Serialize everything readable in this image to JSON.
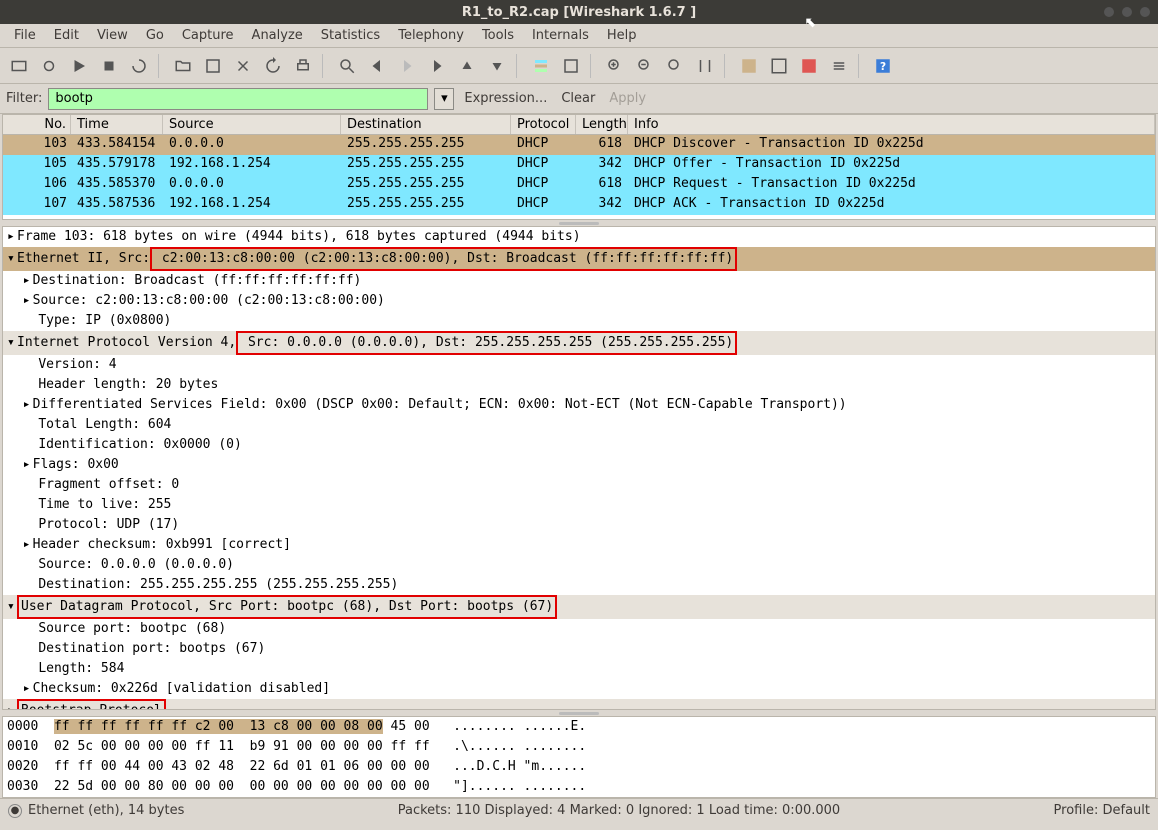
{
  "title": "R1_to_R2.cap   [Wireshark 1.6.7 ]",
  "menu": [
    "File",
    "Edit",
    "View",
    "Go",
    "Capture",
    "Analyze",
    "Statistics",
    "Telephony",
    "Tools",
    "Internals",
    "Help"
  ],
  "filter_label": "Filter:",
  "filter_value": "bootp",
  "filter_actions": {
    "expr": "Expression...",
    "clear": "Clear",
    "apply": "Apply"
  },
  "columns": [
    "No.",
    "Time",
    "Source",
    "Destination",
    "Protocol",
    "Length",
    "Info"
  ],
  "rows": [
    {
      "no": "103",
      "time": "433.584154",
      "src": "0.0.0.0",
      "dst": "255.255.255.255",
      "proto": "DHCP",
      "len": "618",
      "info": "DHCP Discover - Transaction ID 0x225d",
      "sel": true
    },
    {
      "no": "105",
      "time": "435.579178",
      "src": "192.168.1.254",
      "dst": "255.255.255.255",
      "proto": "DHCP",
      "len": "342",
      "info": "DHCP Offer    - Transaction ID 0x225d",
      "sel": false
    },
    {
      "no": "106",
      "time": "435.585370",
      "src": "0.0.0.0",
      "dst": "255.255.255.255",
      "proto": "DHCP",
      "len": "618",
      "info": "DHCP Request  - Transaction ID 0x225d",
      "sel": false
    },
    {
      "no": "107",
      "time": "435.587536",
      "src": "192.168.1.254",
      "dst": "255.255.255.255",
      "proto": "DHCP",
      "len": "342",
      "info": "DHCP ACK      - Transaction ID 0x225d",
      "sel": false
    }
  ],
  "detail": {
    "frame": "Frame 103: 618 bytes on wire (4944 bits), 618 bytes captured (4944 bits)",
    "eth_pre": "Ethernet II, Src:",
    "eth_hl": " c2:00:13:c8:00:00 (c2:00:13:c8:00:00), Dst: Broadcast (ff:ff:ff:ff:ff:ff)",
    "eth_dst": "Destination: Broadcast (ff:ff:ff:ff:ff:ff)",
    "eth_src": "Source: c2:00:13:c8:00:00 (c2:00:13:c8:00:00)",
    "eth_type": "Type: IP (0x0800)",
    "ip_pre": "Internet Protocol Version 4,",
    "ip_hl": " Src: 0.0.0.0 (0.0.0.0), Dst: 255.255.255.255 (255.255.255.255)",
    "ip_ver": "Version: 4",
    "ip_hlen": "Header length: 20 bytes",
    "ip_dsf": "Differentiated Services Field: 0x00 (DSCP 0x00: Default; ECN: 0x00: Not-ECT (Not ECN-Capable Transport))",
    "ip_tl": "Total Length: 604",
    "ip_id": "Identification: 0x0000 (0)",
    "ip_flags": "Flags: 0x00",
    "ip_frag": "Fragment offset: 0",
    "ip_ttl": "Time to live: 255",
    "ip_proto": "Protocol: UDP (17)",
    "ip_csum": "Header checksum: 0xb991 [correct]",
    "ip_src": "Source: 0.0.0.0 (0.0.0.0)",
    "ip_dst": "Destination: 255.255.255.255 (255.255.255.255)",
    "udp_hl": "User Datagram Protocol, Src Port: bootpc (68), Dst Port: bootps (67)",
    "udp_sp": "Source port: bootpc (68)",
    "udp_dp": "Destination port: bootps (67)",
    "udp_len": "Length: 584",
    "udp_csum": "Checksum: 0x226d [validation disabled]",
    "bootp": "Bootstrap Protocol"
  },
  "hex": [
    {
      "off": "0000",
      "b1": "ff ff ff ff ff ff c2 00  13 c8 00 00 08 00",
      "b2": " 45 00",
      "a": "   ........ ......E."
    },
    {
      "off": "0010",
      "b1": "",
      "b2": "02 5c 00 00 00 00 ff 11  b9 91 00 00 00 00 ff ff",
      "a": "   .\\...... ........"
    },
    {
      "off": "0020",
      "b1": "",
      "b2": "ff ff 00 44 00 43 02 48  22 6d 01 01 06 00 00 00",
      "a": "   ...D.C.H \"m......"
    },
    {
      "off": "0030",
      "b1": "",
      "b2": "22 5d 00 00 80 00 00 00  00 00 00 00 00 00 00 00",
      "a": "   \"]...... ........"
    }
  ],
  "status": {
    "left": "Ethernet (eth), 14 bytes",
    "mid": "Packets: 110 Displayed: 4 Marked: 0 Ignored: 1 Load time: 0:00.000",
    "right": "Profile: Default"
  }
}
